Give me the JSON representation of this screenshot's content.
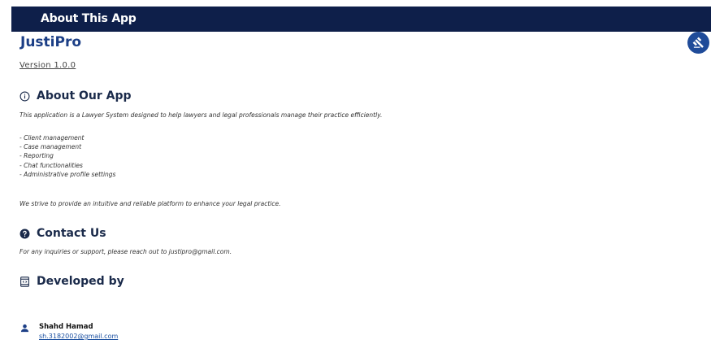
{
  "appbar": {
    "title": "About This App"
  },
  "brand": {
    "name": "JustiPro",
    "version": "Version 1.0.0"
  },
  "about": {
    "title": "About Our App",
    "intro": "This application is a Lawyer System designed to help lawyers and legal professionals manage their practice efficiently.",
    "features": [
      "- Client management",
      "- Case management",
      "- Reporting",
      "- Chat functionalities",
      "- Administrative profile settings"
    ],
    "closing": "We strive to provide an intuitive and reliable platform to enhance your legal practice."
  },
  "contact": {
    "title": "Contact Us",
    "text": "For any inquiries or support, please reach out to justipro@gmail.com."
  },
  "developed": {
    "title": "Developed by",
    "developer": {
      "name": "Shahd Hamad",
      "email": "sh.3182002@gmail.com"
    }
  },
  "colors": {
    "appbar": "#0e1f4a",
    "brand": "#1c3f86",
    "fab": "#1f4b99",
    "link": "#1a4fa0"
  },
  "icons": {
    "about": "info-icon",
    "contact": "help-icon",
    "developed": "developer-board-icon",
    "developer": "person-icon",
    "fab": "gavel-icon"
  }
}
